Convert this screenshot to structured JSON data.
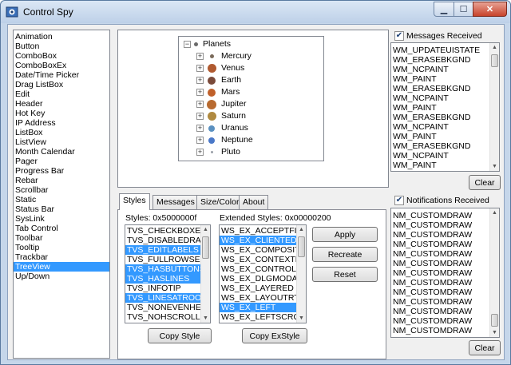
{
  "window": {
    "title": "Control Spy",
    "min_label": "▁",
    "max_label": "☐",
    "close_label": "✕"
  },
  "controls": [
    "Animation",
    "Button",
    "ComboBox",
    "ComboBoxEx",
    "Date/Time Picker",
    "Drag ListBox",
    "Edit",
    "Header",
    "Hot Key",
    "IP Address",
    "ListBox",
    "ListView",
    "Month Calendar",
    "Pager",
    "Progress Bar",
    "Rebar",
    "Scrollbar",
    "Static",
    "Status Bar",
    "SysLink",
    "Tab Control",
    "Toolbar",
    "Tooltip",
    "Trackbar",
    "TreeView",
    "Up/Down"
  ],
  "selected_control": "TreeView",
  "tree": {
    "root": "Planets",
    "children": [
      {
        "label": "Mercury",
        "color": "#7a6a5a"
      },
      {
        "label": "Venus",
        "color": "#b05a30"
      },
      {
        "label": "Earth",
        "color": "#7a4a3a"
      },
      {
        "label": "Mars",
        "color": "#c0602a"
      },
      {
        "label": "Jupiter",
        "color": "#b86a30"
      },
      {
        "label": "Saturn",
        "color": "#b08a40"
      },
      {
        "label": "Uranus",
        "color": "#5a90c0"
      },
      {
        "label": "Neptune",
        "color": "#4a78c8"
      },
      {
        "label": "Pluto",
        "color": "#9aa0a8"
      }
    ]
  },
  "tabs": [
    "Styles",
    "Messages",
    "Size/Color",
    "About"
  ],
  "styles": {
    "label": "Styles: 0x5000000f",
    "items": [
      {
        "text": "TVS_CHECKBOXES",
        "sel": false
      },
      {
        "text": "TVS_DISABLEDRAGD",
        "sel": false
      },
      {
        "text": "TVS_EDITLABELS",
        "sel": true
      },
      {
        "text": "TVS_FULLROWSELEC",
        "sel": false
      },
      {
        "text": "TVS_HASBUTTONS",
        "sel": true
      },
      {
        "text": "TVS_HASLINES",
        "sel": true
      },
      {
        "text": "TVS_INFOTIP",
        "sel": false
      },
      {
        "text": "TVS_LINESATROOT",
        "sel": true
      },
      {
        "text": "TVS_NONEVENHEIGH",
        "sel": false
      },
      {
        "text": "TVS_NOHSCROLL",
        "sel": false
      }
    ],
    "copy_label": "Copy Style"
  },
  "ex_styles": {
    "label": "Extended Styles: 0x00000200",
    "items": [
      {
        "text": "WS_EX_ACCEPTFILE",
        "sel": false
      },
      {
        "text": "WS_EX_CLIENTEDGE",
        "sel": true
      },
      {
        "text": "WS_EX_COMPOSITE",
        "sel": false
      },
      {
        "text": "WS_EX_CONTEXTHE",
        "sel": false
      },
      {
        "text": "WS_EX_CONTROLPA",
        "sel": false
      },
      {
        "text": "WS_EX_DLGMODALF",
        "sel": false
      },
      {
        "text": "WS_EX_LAYERED",
        "sel": false
      },
      {
        "text": "WS_EX_LAYOUTRTL",
        "sel": false
      },
      {
        "text": "WS_EX_LEFT",
        "sel": true
      },
      {
        "text": "WS_EX_LEFTSCROLL",
        "sel": false
      }
    ],
    "copy_label": "Copy ExStyle"
  },
  "actions": {
    "apply": "Apply",
    "recreate": "Recreate",
    "reset": "Reset"
  },
  "messages": {
    "checkbox_label": "Messages Received",
    "checked": true,
    "items": [
      "WM_UPDATEUISTATE",
      "WM_ERASEBKGND",
      "WM_NCPAINT",
      "WM_PAINT",
      "WM_ERASEBKGND",
      "WM_NCPAINT",
      "WM_PAINT",
      "WM_ERASEBKGND",
      "WM_NCPAINT",
      "WM_PAINT",
      "WM_ERASEBKGND",
      "WM_NCPAINT",
      "WM_PAINT"
    ],
    "clear_label": "Clear"
  },
  "notifications": {
    "checkbox_label": "Notifications Received",
    "checked": true,
    "items": [
      "NM_CUSTOMDRAW",
      "NM_CUSTOMDRAW",
      "NM_CUSTOMDRAW",
      "NM_CUSTOMDRAW",
      "NM_CUSTOMDRAW",
      "NM_CUSTOMDRAW",
      "NM_CUSTOMDRAW",
      "NM_CUSTOMDRAW",
      "NM_CUSTOMDRAW",
      "NM_CUSTOMDRAW",
      "NM_CUSTOMDRAW",
      "NM_CUSTOMDRAW",
      "NM_CUSTOMDRAW"
    ],
    "clear_label": "Clear"
  }
}
